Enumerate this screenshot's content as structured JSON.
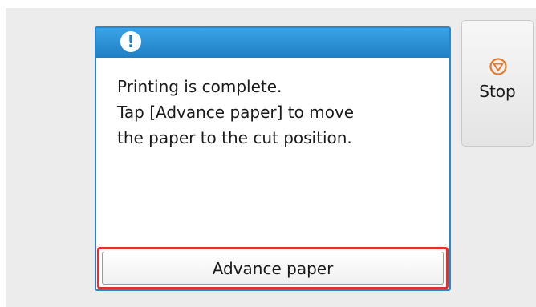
{
  "dialog": {
    "icon": "alert-exclamation-icon",
    "header_color": "#2b86c7",
    "message_lines": [
      "Printing is complete.",
      "Tap [Advance paper] to move",
      "the paper to the cut position."
    ],
    "primary_button": {
      "label": "Advance paper",
      "highlight_color": "#e0322d"
    }
  },
  "side_panel": {
    "stop_button": {
      "icon": "stop-icon",
      "label": "Stop",
      "icon_color": "#e8792b"
    }
  }
}
